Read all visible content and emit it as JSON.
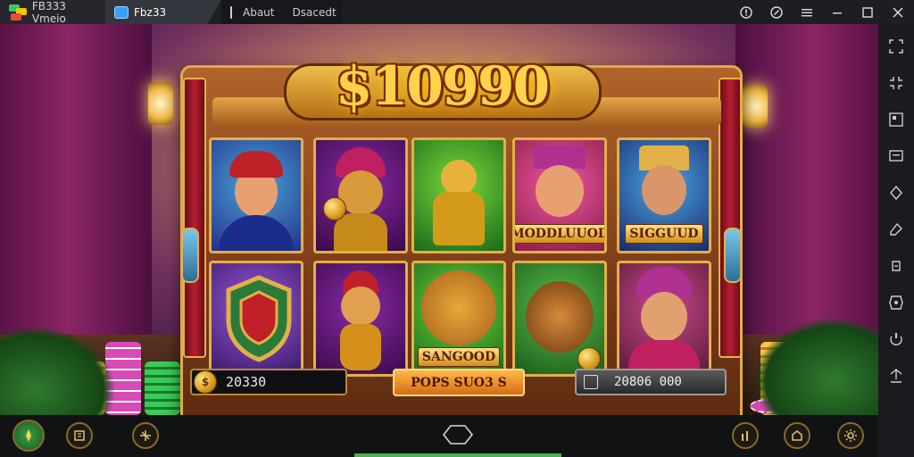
{
  "window": {
    "app_tab_label": "FB333 Vmeio",
    "active_tab_label": "Fbz33",
    "third_tab_label_a": "Abaut",
    "third_tab_label_b": "Dsacedt"
  },
  "game": {
    "jackpot": "$10990",
    "reel_labels": [
      "MODDLUUOD",
      "SIGGUUD",
      "SANGOOD"
    ],
    "bottom_left_value": "20330",
    "bottom_left_coin_icon": "coin-icon",
    "spin_button_label": "POPS SUO3 S",
    "bottom_right_value": "20806 000"
  },
  "colors": {
    "accent_gold": "#e2b048",
    "curtain": "#8c2566",
    "spin_button": "#f09030"
  }
}
